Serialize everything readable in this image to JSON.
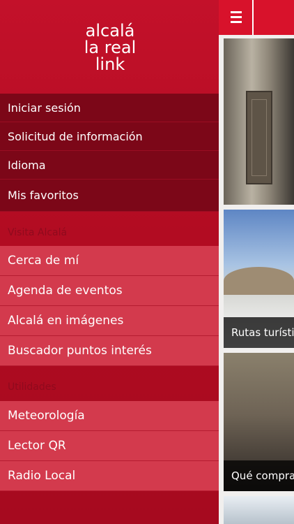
{
  "logo": {
    "line1": "alcalá",
    "line2": "la real",
    "line3": "link"
  },
  "account_menu": [
    {
      "label": "Iniciar sesión"
    },
    {
      "label": "Solicitud de información"
    },
    {
      "label": "Idioma"
    },
    {
      "label": "Mis favoritos"
    }
  ],
  "visit_section": {
    "heading": "Visita Alcalá",
    "items": [
      {
        "label": "Cerca de mí"
      },
      {
        "label": "Agenda de eventos"
      },
      {
        "label": "Alcalá en imágenes"
      },
      {
        "label": "Buscador puntos interés"
      }
    ]
  },
  "utilities_section": {
    "heading": "Utilidades",
    "items": [
      {
        "label": "Meteorología"
      },
      {
        "label": "Lector QR"
      },
      {
        "label": "Radio Local"
      }
    ]
  },
  "tiles": [
    {
      "caption": ""
    },
    {
      "caption": "Rutas turísti"
    },
    {
      "caption": "Qué compra"
    },
    {
      "caption": ""
    }
  ],
  "colors": {
    "brand_red": "#d8122b",
    "drawer_red": "#b20c22",
    "dark_red": "#7c0718"
  },
  "icons": {
    "menu": "hamburger-menu-icon"
  }
}
